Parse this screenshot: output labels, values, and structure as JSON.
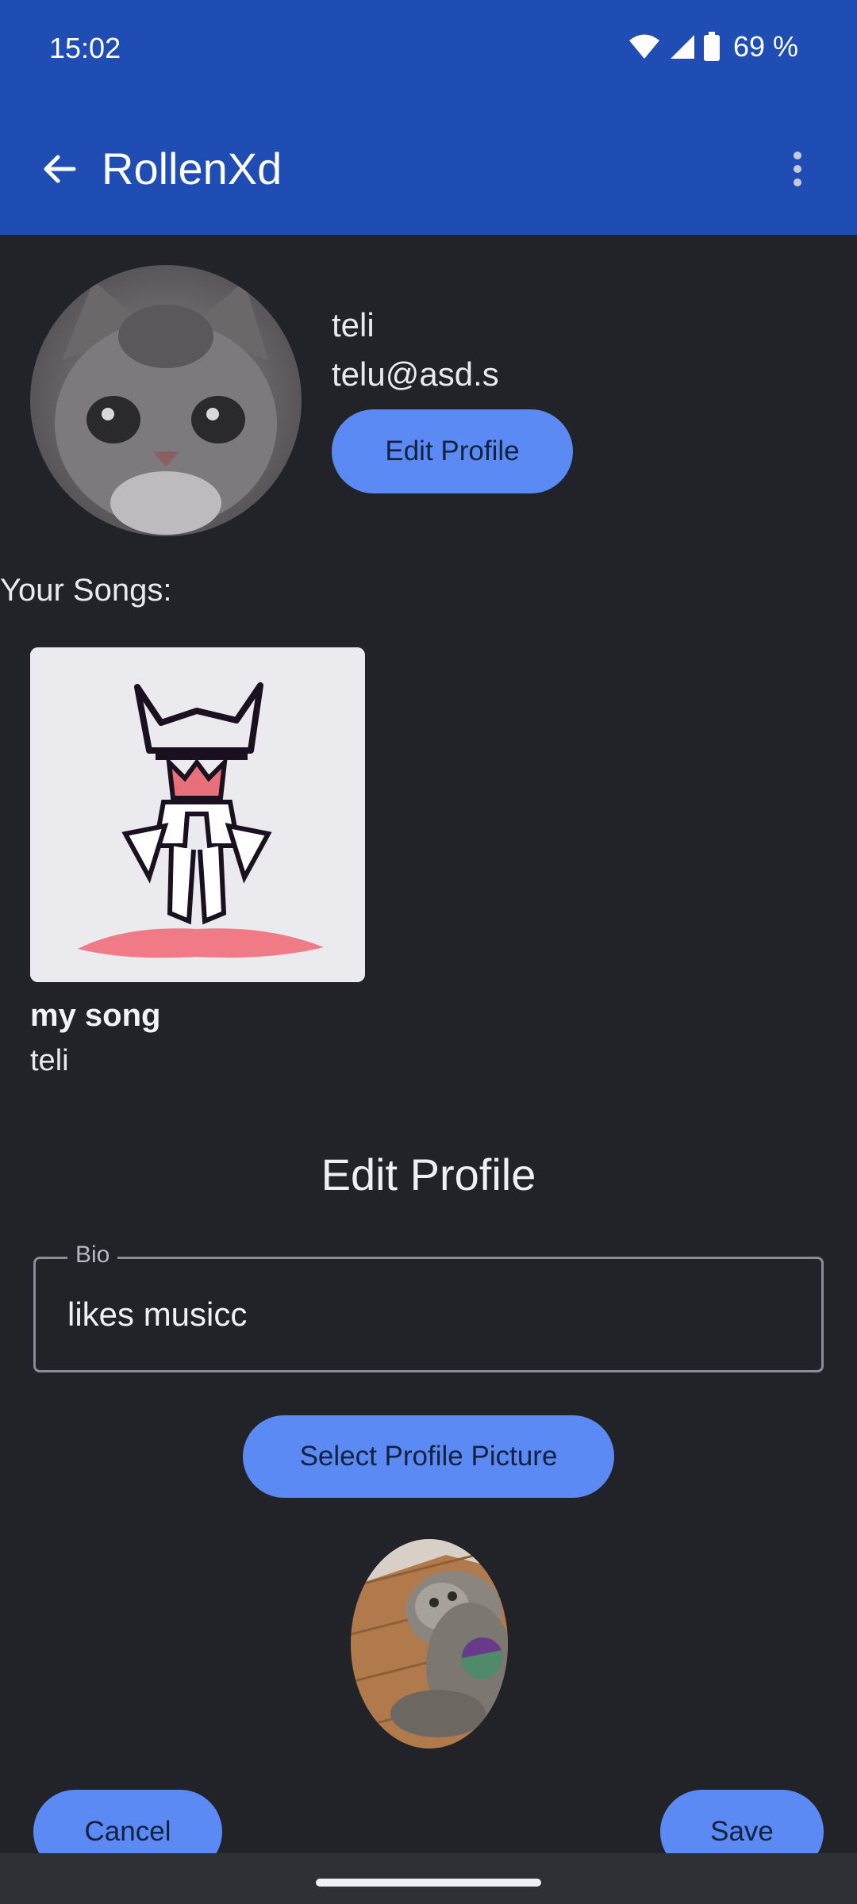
{
  "status_bar": {
    "time": "15:02",
    "battery_text": "69 %",
    "icons": [
      "wifi-icon",
      "signal-icon",
      "battery-icon"
    ]
  },
  "app_bar": {
    "title": "RollenXd",
    "back_icon": "arrow-left-icon",
    "menu_icon": "more-vert-icon"
  },
  "profile": {
    "name": "teli",
    "email": "telu@asd.s",
    "edit_button": "Edit Profile"
  },
  "songs": {
    "heading": "Your Songs:",
    "items": [
      {
        "title": "my song",
        "artist": "teli"
      }
    ]
  },
  "edit_form": {
    "heading": "Edit Profile",
    "bio_label": "Bio",
    "bio_value": "likes musicc",
    "select_picture_button": "Select Profile Picture",
    "cancel_button": "Cancel",
    "save_button": "Save"
  },
  "colors": {
    "app_bar": "#1f4db4",
    "background": "#212329",
    "button": "#5b8af5",
    "button_text": "#142240"
  }
}
